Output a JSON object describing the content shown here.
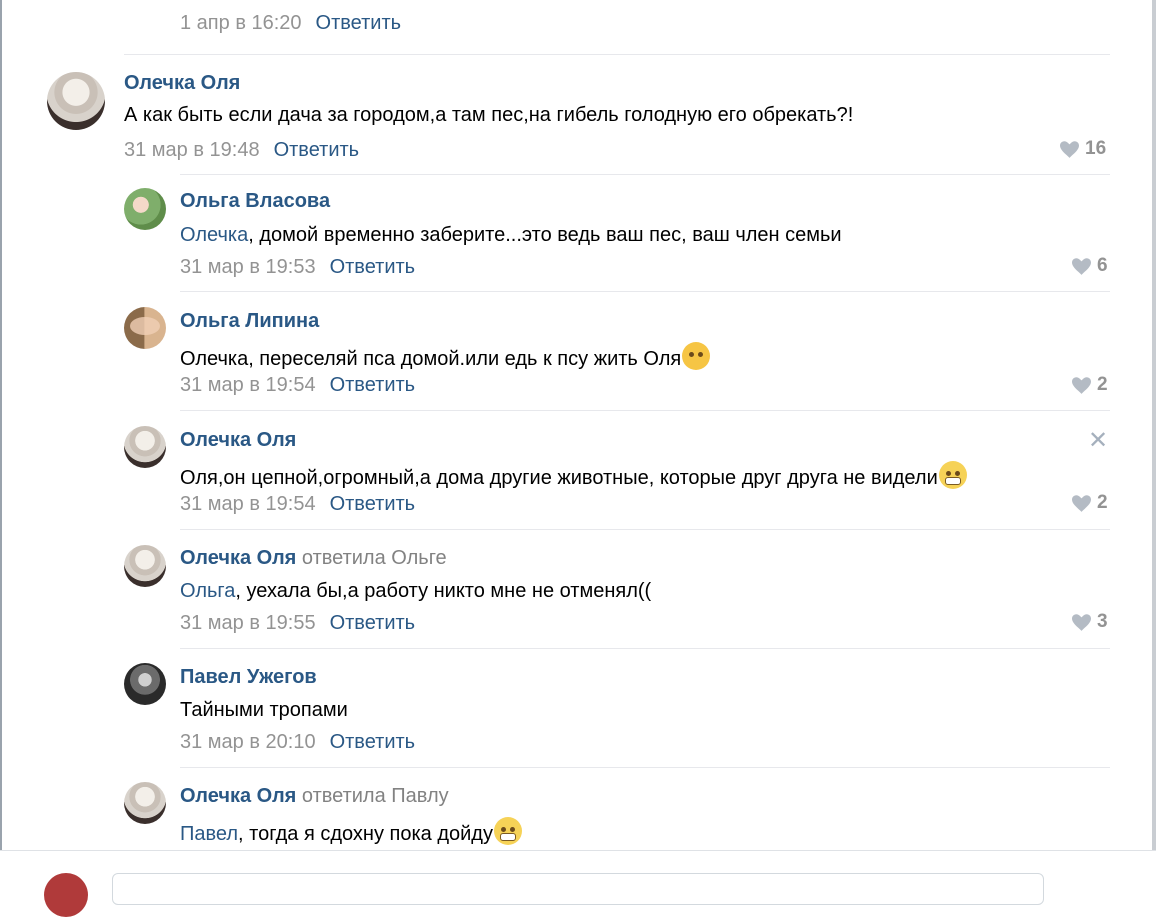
{
  "comments": [
    {
      "date": "1 апр в 16:20",
      "reply": "Ответить"
    },
    {
      "author": "Олечка Оля",
      "text": "А как быть если дача за городом,а там пес,на гибель голодную его обрекать?!",
      "date": "31 мар в 19:48",
      "reply": "Ответить",
      "likes": "16"
    },
    {
      "author": "Ольга Власова",
      "mention": "Олечка",
      "text": ", домой временно заберите...это ведь ваш пес, ваш член семьи",
      "date": "31 мар в 19:53",
      "reply": "Ответить",
      "likes": "6"
    },
    {
      "author": "Ольга Липина",
      "text": "Олечка, переселяй пса домой.или едь к псу жить Оля",
      "emoji": "rolling-laughing-emoji",
      "date": "31 мар в 19:54",
      "reply": "Ответить",
      "likes": "2"
    },
    {
      "author": "Олечка Оля",
      "text": "Оля,он цепной,огромный,а дома другие животные, которые друг друга не видели",
      "emoji": "grimacing-emoji",
      "date": "31 мар в 19:54",
      "reply": "Ответить",
      "likes": "2",
      "close": "✕"
    },
    {
      "author": "Олечка Оля",
      "reply_to": "ответила Ольге",
      "mention": "Ольга",
      "text": ", уехала бы,а работу никто мне не отменял((",
      "date": "31 мар в 19:55",
      "reply": "Ответить",
      "likes": "3"
    },
    {
      "author": "Павел Ужегов",
      "text": "Тайными тропами",
      "date": "31 мар в 20:10",
      "reply": "Ответить"
    },
    {
      "author": "Олечка Оля",
      "reply_to": "ответила Павлу",
      "mention": "Павел",
      "text": ", тогда я сдохну пока дойду",
      "emoji": "grimacing-emoji"
    }
  ],
  "colors": {
    "link": "#2a5885",
    "meta": "#939393",
    "separator": "#e7e8ec",
    "text": "#000000"
  },
  "icons": {
    "like": "heart-icon",
    "remove": "close-icon"
  }
}
